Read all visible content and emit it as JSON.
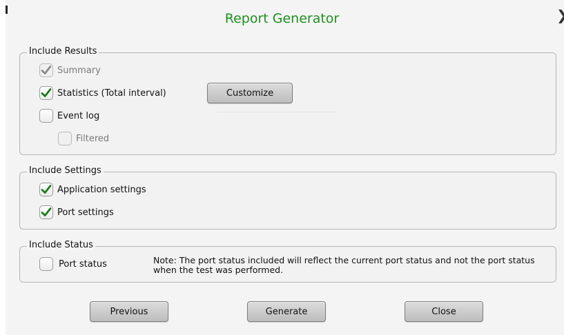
{
  "dialog": {
    "title": "Report Generator",
    "close_icon": "close-x-icon"
  },
  "include_results": {
    "legend": "Include Results",
    "summary": {
      "label": "Summary",
      "checked": true,
      "enabled": false
    },
    "statistics": {
      "label": "Statistics (Total interval)",
      "checked": true,
      "enabled": true
    },
    "customize_label": "Customize",
    "event_log": {
      "label": "Event log",
      "checked": false,
      "enabled": true
    },
    "filtered": {
      "label": "Filtered",
      "checked": false,
      "enabled": false
    }
  },
  "include_settings": {
    "legend": "Include Settings",
    "application_settings": {
      "label": "Application settings",
      "checked": true
    },
    "port_settings": {
      "label": "Port settings",
      "checked": true
    }
  },
  "include_status": {
    "legend": "Include Status",
    "port_status": {
      "label": "Port status",
      "checked": false
    },
    "note": "Note:  The port status included will reflect the current port status and not the port status when the test was performed."
  },
  "buttons": {
    "previous": "Previous",
    "generate": "Generate",
    "close": "Close"
  },
  "colors": {
    "title": "#1e8f1e",
    "check_enabled": "#1a7a1a",
    "check_disabled": "#888888"
  }
}
